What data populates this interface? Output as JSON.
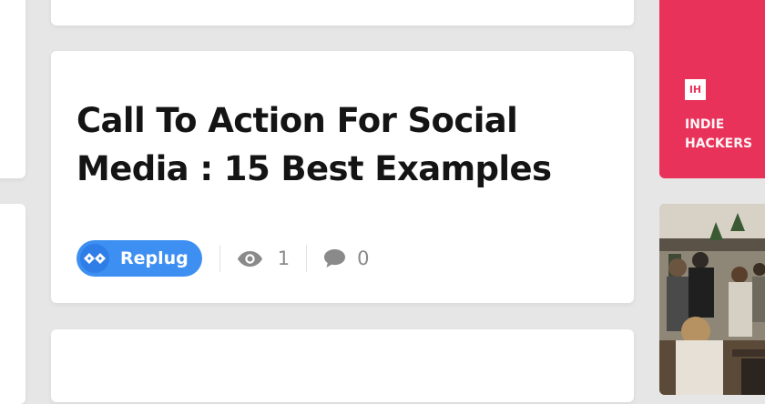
{
  "post": {
    "title": "Call To Action For Social Media : 15 Best Examples",
    "author": "Replug",
    "views": "1",
    "comments": "0"
  },
  "sidebar": {
    "brand_label": "INDIE HACKERS",
    "brand_logo_text": "IH",
    "brand_color": "#e8325a"
  },
  "colors": {
    "author_pill": "#3d8ff2",
    "meta_gray": "#8a8a8a"
  },
  "icons": [
    "replug-logo-icon",
    "eye-icon",
    "comment-icon"
  ]
}
